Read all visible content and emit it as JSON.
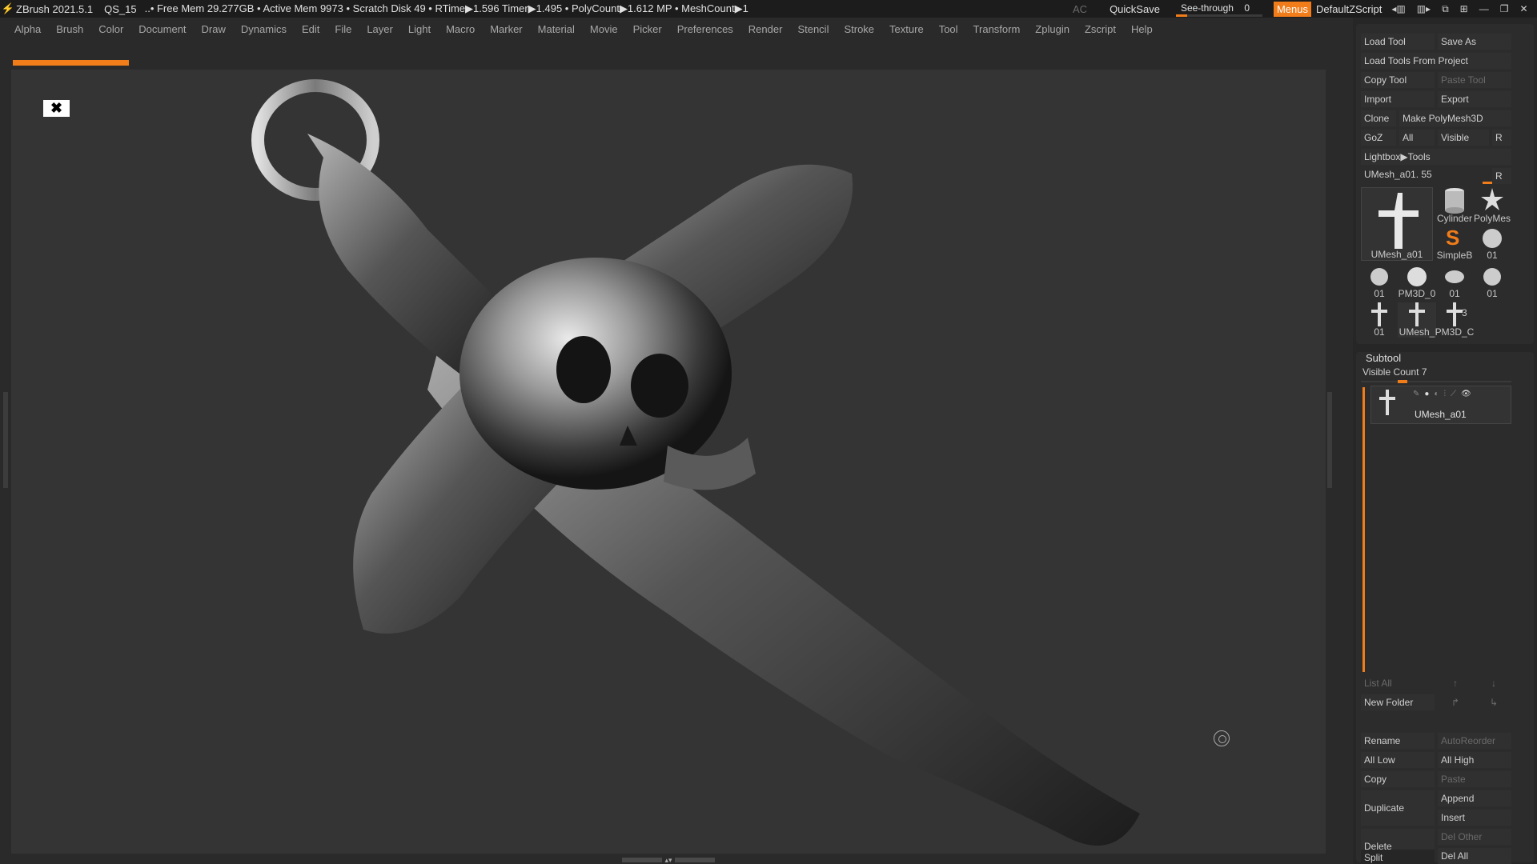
{
  "titlebar": {
    "app_title": "ZBrush 2021.5.1",
    "project": "QS_15",
    "stats": "..• Free Mem 29.277GB • Active Mem 9973 • Scratch Disk 49 • RTime▶1.596 Timer▶1.495 • PolyCount▶1.612 MP • MeshCount▶1",
    "ac_label": "AC",
    "quicksave_label": "QuickSave",
    "seethrough_label": "See-through",
    "seethrough_value": "0",
    "menus_label": "Menus",
    "script_label": "DefaultZScript"
  },
  "menubar": [
    "Alpha",
    "Brush",
    "Color",
    "Document",
    "Draw",
    "Dynamics",
    "Edit",
    "File",
    "Layer",
    "Light",
    "Macro",
    "Marker",
    "Material",
    "Movie",
    "Picker",
    "Preferences",
    "Render",
    "Stencil",
    "Stroke",
    "Texture",
    "Tool",
    "Transform",
    "Zplugin",
    "Zscript",
    "Help"
  ],
  "tool_panel": {
    "load_tool": "Load Tool",
    "save_as": "Save As",
    "load_tools_from_project": "Load Tools From Project",
    "copy_tool": "Copy Tool",
    "paste_tool": "Paste Tool",
    "import": "Import",
    "export": "Export",
    "clone": "Clone",
    "make_polymesh": "Make PolyMesh3D",
    "goz": "GoZ",
    "all": "All",
    "visible": "Visible",
    "r": "R",
    "lightbox_tools": "Lightbox▶Tools",
    "current_tool": "UMesh_a01. 55",
    "r2": "R",
    "thumbnails": [
      "UMesh_a01",
      "Cylinder",
      "PolyMes",
      "SimpleB",
      "01",
      "01",
      "PM3D_0",
      "01",
      "01",
      "01",
      "UMesh_",
      "PM3D_C"
    ],
    "thumb_badge": "3"
  },
  "subtool": {
    "title": "Subtool",
    "visible_count": "Visible Count 7",
    "item_name": "UMesh_a01",
    "list_all": "List All",
    "new_folder": "New Folder",
    "rename": "Rename",
    "autoreorder": "AutoReorder",
    "all_low": "All Low",
    "all_high": "All High",
    "copy": "Copy",
    "paste": "Paste",
    "duplicate": "Duplicate",
    "append": "Append",
    "insert": "Insert",
    "delete": "Delete",
    "del_other": "Del Other",
    "del_all": "Del All",
    "split": "Split"
  },
  "colors": {
    "accent": "#f07c1a",
    "viewport": "#343434",
    "panel": "#262626"
  },
  "seethrough_fraction": 0.0
}
